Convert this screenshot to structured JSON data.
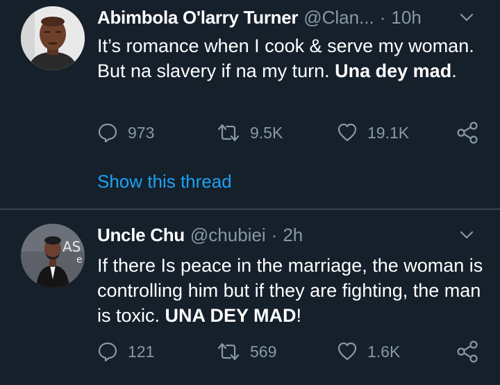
{
  "colors": {
    "background": "#15202b",
    "text_primary": "#ffffff",
    "text_secondary": "#8899a6",
    "link": "#1da1f2",
    "divider": "#38444d"
  },
  "tweets": [
    {
      "name": "Abimbola O'larry Turner",
      "handle": "@Clan...",
      "separator": "·",
      "time": "10h",
      "text_part1": "It’s romance when I cook & serve my woman. But na slavery if na my turn. ",
      "text_bold": "Una dey mad",
      "text_part2": ".",
      "replies": "973",
      "retweets": "9.5K",
      "likes": "19.1K",
      "show_thread": "Show this thread",
      "icons": [
        "reply-icon",
        "retweet-icon",
        "like-icon",
        "share-icon",
        "chevron-down-icon"
      ]
    },
    {
      "name": "Uncle Chu",
      "handle": "@chubiei",
      "separator": "·",
      "time": "2h",
      "text_part1": "If there Is peace in the marriage, the woman is controlling him but if they are fighting, the man is toxic. ",
      "text_bold": "UNA DEY MAD",
      "text_part2": "!",
      "replies": "121",
      "retweets": "569",
      "likes": "1.6K",
      "icons": [
        "reply-icon",
        "retweet-icon",
        "like-icon",
        "share-icon",
        "chevron-down-icon"
      ]
    }
  ]
}
